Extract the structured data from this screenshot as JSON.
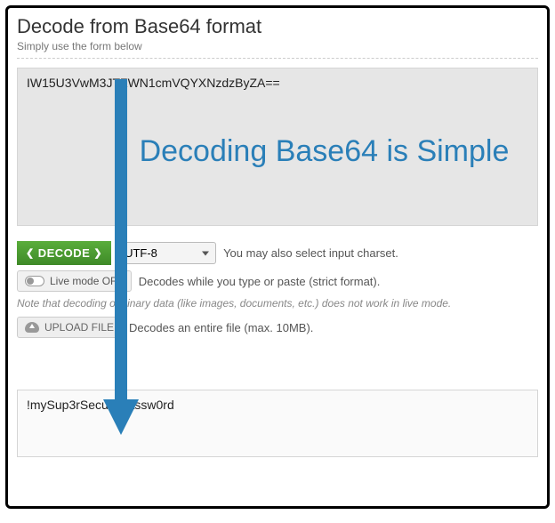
{
  "header": {
    "title": "Decode from Base64 format",
    "subtitle": "Simply use the form below"
  },
  "input": {
    "value": "IW15U3VwM3JTZWN1cmVQYXNzdzByZA=="
  },
  "controls": {
    "decode_label": "DECODE",
    "charset_selected": "UTF-8",
    "charset_hint": "You may also select input charset.",
    "live_label": "Live mode OFF",
    "live_hint": "Decodes while you type or paste (strict format).",
    "note": "Note that decoding of binary data (like images, documents, etc.) does not work in live mode.",
    "upload_label": "UPLOAD FILE",
    "upload_hint": "Decodes an entire file (max. 10MB)."
  },
  "output": {
    "value": "!mySup3rSecurePassw0rd"
  },
  "annotation": {
    "text": "Decoding Base64 is Simple"
  }
}
